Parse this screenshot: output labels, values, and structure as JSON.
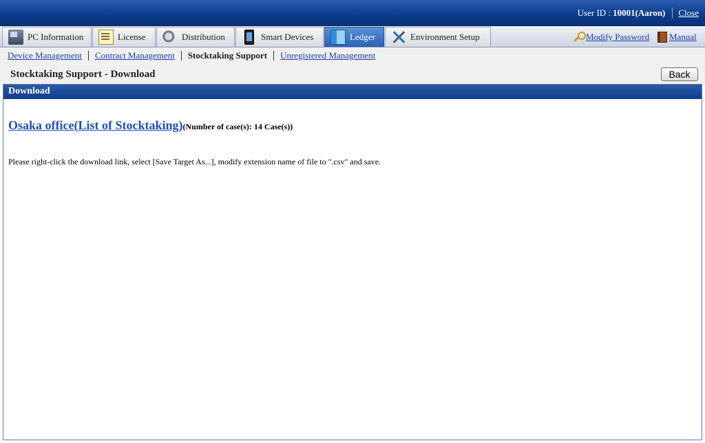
{
  "header": {
    "user_id_label": "User ID :",
    "user_id_value": "10001(Aaron)",
    "close_label": "Close"
  },
  "tabs": [
    {
      "label": "PC Information",
      "icon": "pc-icon"
    },
    {
      "label": "License",
      "icon": "license-icon"
    },
    {
      "label": "Distribution",
      "icon": "distribution-icon"
    },
    {
      "label": "Smart Devices",
      "icon": "smart-device-icon"
    },
    {
      "label": "Ledger",
      "icon": "ledger-icon",
      "active": true
    },
    {
      "label": "Environment Setup",
      "icon": "tools-icon"
    }
  ],
  "toolbar": {
    "modify_password": "Modify Password",
    "manual": "Manual"
  },
  "subnav": {
    "device_management": "Device Management",
    "contract_management": "Contract Management",
    "stocktaking_support": "Stocktaking Support",
    "unregistered_management": "Unregistered Management"
  },
  "page": {
    "title": "Stocktaking Support - Download",
    "back_label": "Back"
  },
  "panel": {
    "heading": "Download",
    "download_link": "Osaka office(List of Stocktaking)",
    "case_count": "(Number of case(s): 14 Case(s))",
    "note": "Please right-click the download link, select [Save Target As...], modify extension name of file to \".csv\" and save."
  },
  "colors": {
    "header_blue": "#0d3c8c",
    "active_tab": "#2a62b6",
    "link": "#1d3fa8"
  }
}
